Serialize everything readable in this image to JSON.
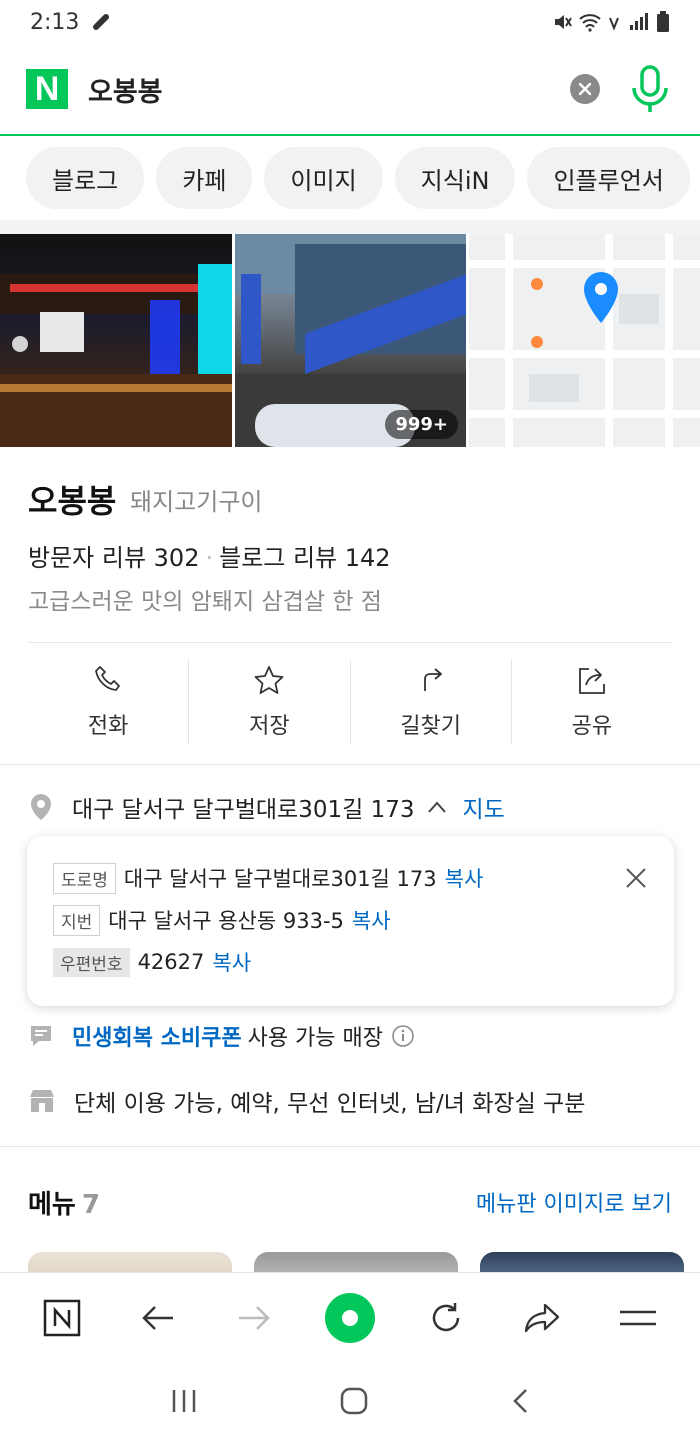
{
  "status_bar": {
    "time": "2:13"
  },
  "search": {
    "query": "오봉봉",
    "logo_letter": "N"
  },
  "tabs": [
    "블로그",
    "카페",
    "이미지",
    "지식iN",
    "인플루언서"
  ],
  "photos": {
    "count_badge": "999+"
  },
  "place": {
    "name": "오봉봉",
    "category": "돼지고기구이",
    "visitor_reviews": "방문자 리뷰 302",
    "blog_reviews": "블로그 리뷰 142",
    "description": "고급스러운 맛의 암퇘지 삼겹살 한 점"
  },
  "actions": [
    {
      "label": "전화"
    },
    {
      "label": "저장"
    },
    {
      "label": "길찾기"
    },
    {
      "label": "공유"
    }
  ],
  "address": {
    "summary": "대구 달서구 달구벌대로301길 173",
    "map_link": "지도",
    "card": {
      "road_tag": "도로명",
      "road": "대구 달서구 달구벌대로301길 173",
      "lot_tag": "지번",
      "lot": "대구 달서구 용산동 933-5",
      "zip_tag": "우편번호",
      "zip": "42627",
      "copy": "복사"
    }
  },
  "coupon": {
    "highlight": "민생회복 소비쿠폰",
    "text": "사용 가능 매장"
  },
  "amenities": "단체 이용 가능, 예약, 무선 인터넷, 남/녀 화장실 구분",
  "menu": {
    "title": "메뉴",
    "count": "7",
    "link": "메뉴판 이미지로 보기"
  },
  "colors": {
    "naver_green": "#03c75a",
    "link_blue": "#0068c3"
  }
}
